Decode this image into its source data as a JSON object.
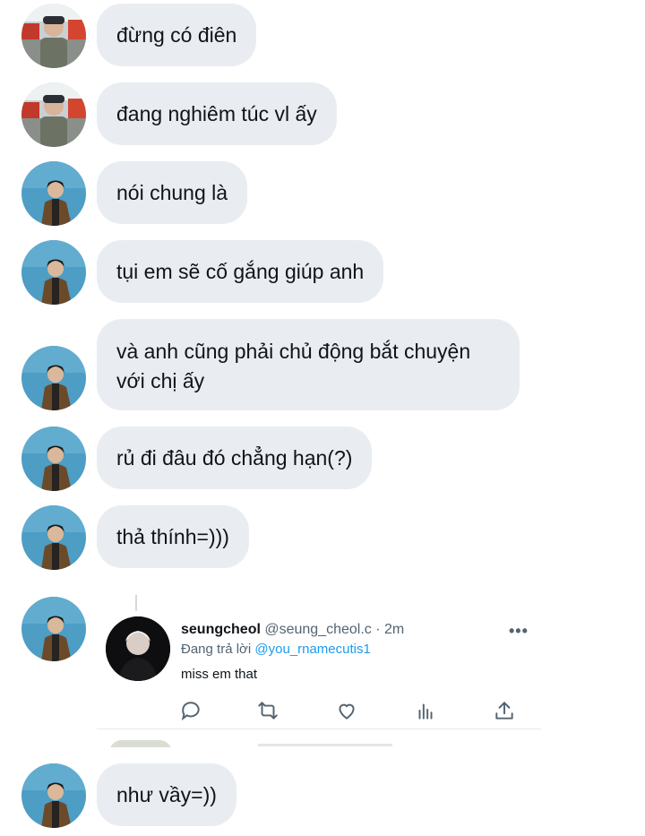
{
  "messages": [
    {
      "text": "đừng có điên",
      "avatar": "friend-photo"
    },
    {
      "text": "đang nghiêm túc vl ấy",
      "avatar": "friend-photo"
    },
    {
      "text": "nói chung là",
      "avatar": "user-photo"
    },
    {
      "text": "tụi em sẽ cố gắng giúp anh",
      "avatar": "user-photo"
    },
    {
      "text": "và anh cũng phải chủ động bắt chuyện với chị ấy",
      "line1": "và anh cũng phải chủ động bắt chuyện",
      "line2": "với chị ấy",
      "avatar": "user-photo"
    },
    {
      "text": "rủ đi đâu đó chẳng hạn(?)",
      "avatar": "user-photo"
    },
    {
      "text": "thả thính=)))",
      "avatar": "user-photo"
    },
    {
      "text": "như vầy=))",
      "avatar": "user-photo"
    }
  ],
  "tweet": {
    "name": "seungcheol",
    "handle": "@seung_cheol.c",
    "dot": "·",
    "time": "2m",
    "more": "•••",
    "reply_prefix": "Đang trả lời",
    "reply_to": "@you_rnamecutis1",
    "text": "miss em that",
    "actions": [
      "reply-icon",
      "retweet-icon",
      "like-icon",
      "views-icon",
      "share-icon"
    ]
  },
  "colors": {
    "bubble": "#e9edf1",
    "mention": "#1d9bf0",
    "secondary_text": "#536471"
  }
}
